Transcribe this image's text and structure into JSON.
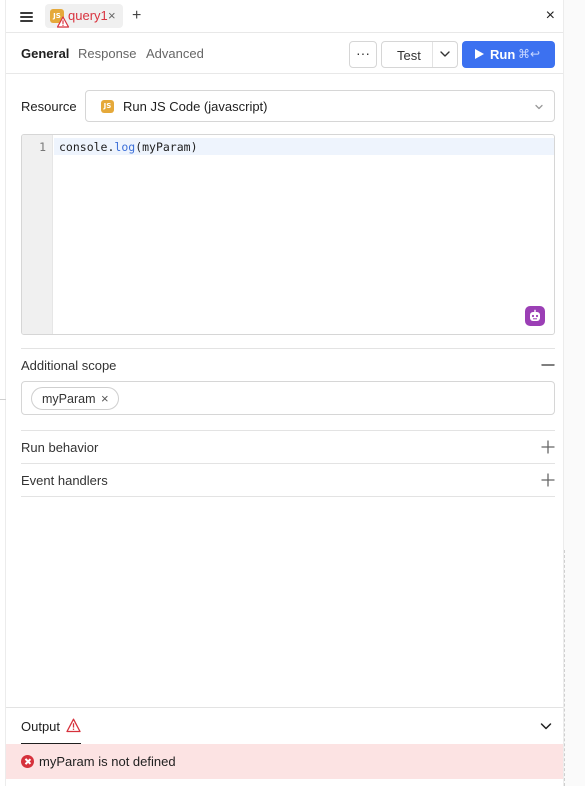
{
  "tab": {
    "badge": "JS",
    "label": "query1",
    "close": "×",
    "add": "+"
  },
  "panel": {
    "close": "×"
  },
  "nav": {
    "tabs": [
      {
        "label": "General",
        "active": true
      },
      {
        "label": "Response",
        "active": false
      },
      {
        "label": "Advanced",
        "active": false
      }
    ],
    "more": "···",
    "test_label": "Test",
    "run_label": "Run",
    "run_shortcut": "⌘↩"
  },
  "resource": {
    "label": "Resource",
    "badge": "JS",
    "value": "Run JS Code (javascript)"
  },
  "editor": {
    "line_number": "1",
    "code_object": "console",
    "code_dot": ".",
    "code_method": "log",
    "code_args": "(myParam)"
  },
  "additional_scope": {
    "label": "Additional scope",
    "chips": [
      "myParam"
    ],
    "chip_remove": "×"
  },
  "run_behavior": {
    "label": "Run behavior"
  },
  "event_handlers": {
    "label": "Event handlers"
  },
  "output": {
    "label": "Output",
    "error_message": "myParam is not defined"
  },
  "colors": {
    "accent": "#3c71f0",
    "error": "#d6313c",
    "error_bg": "#fce3e3",
    "js_badge": "#e5a93a",
    "ai_button": "#9b3fb5"
  }
}
